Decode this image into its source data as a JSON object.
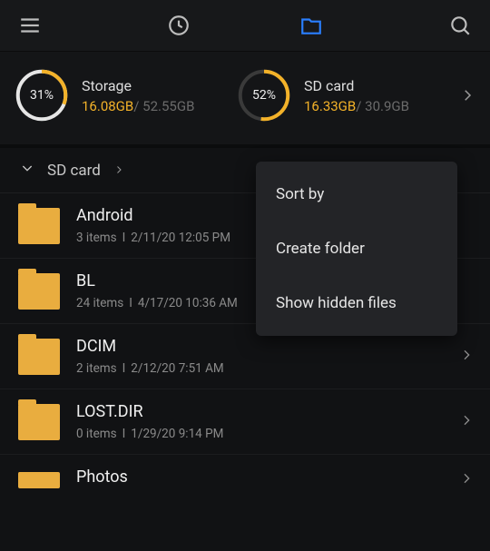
{
  "storage": [
    {
      "id": "internal",
      "label": "Storage",
      "percent": "31%",
      "used": "16.08GB",
      "total": "52.55GB",
      "arc_dashoffset": 113.7
    },
    {
      "id": "sdcard",
      "label": "SD card",
      "percent": "52%",
      "used": "16.33GB",
      "total": "30.9GB",
      "arc_dashoffset": 79.1
    }
  ],
  "breadcrumb": {
    "location": "SD card"
  },
  "menu": {
    "sort": "Sort by",
    "create": "Create folder",
    "hidden": "Show hidden files"
  },
  "folders": [
    {
      "name": "Android",
      "count": "3 items",
      "date": "2/11/20 12:05 PM",
      "chevron": false
    },
    {
      "name": "BL",
      "count": "24 items",
      "date": "4/17/20 10:36 AM",
      "chevron": false
    },
    {
      "name": "DCIM",
      "count": "2 items",
      "date": "2/12/20 7:51 AM",
      "chevron": true
    },
    {
      "name": "LOST.DIR",
      "count": "0 items",
      "date": "1/29/20 9:14 PM",
      "chevron": true
    },
    {
      "name": "Photos",
      "count": "",
      "date": "",
      "chevron": true
    }
  ]
}
